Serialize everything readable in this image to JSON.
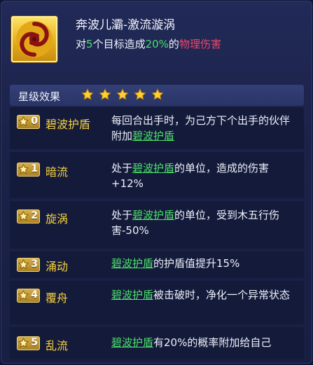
{
  "skill": {
    "title": "奔波儿灞-激流漩涡",
    "icon": "whirlpool-swirl-icon",
    "description": {
      "prefix": "对",
      "target_count": "5",
      "mid": "个目标造成",
      "percent": "20%",
      "of": "的",
      "damage_type": "物理伤害"
    }
  },
  "star_effects": {
    "header_label": "星级效果",
    "star_rating": 5,
    "rows": [
      {
        "level": "0",
        "name": "碧波护盾",
        "effect": {
          "a": "每回合出手时，为己方下个出手的伙伴附加",
          "link": "碧波护盾",
          "b": ""
        }
      },
      {
        "level": "1",
        "name": "暗流",
        "effect": {
          "a": "处于",
          "link": "碧波护盾",
          "b": "的单位，造成的伤害+12%"
        }
      },
      {
        "level": "2",
        "name": "旋涡",
        "effect": {
          "a": "处于",
          "link": "碧波护盾",
          "b": "的单位，受到木五行伤害-50%"
        }
      },
      {
        "level": "3",
        "name": "涌动",
        "effect": {
          "a": "",
          "link": "碧波护盾",
          "b": "的护盾值提升15%"
        }
      },
      {
        "level": "4",
        "name": "覆舟",
        "effect": {
          "a": "",
          "link": "碧波护盾",
          "b": "被击破时，净化一个异常状态"
        }
      },
      {
        "level": "5",
        "name": "乱流",
        "effect": {
          "a": "",
          "link": "碧波护盾",
          "b": "有20%的概率附加给自己"
        }
      }
    ]
  },
  "colors": {
    "highlight_green": "#4be06a",
    "damage_red": "#f0476b",
    "name_gold": "#f6d23e"
  }
}
